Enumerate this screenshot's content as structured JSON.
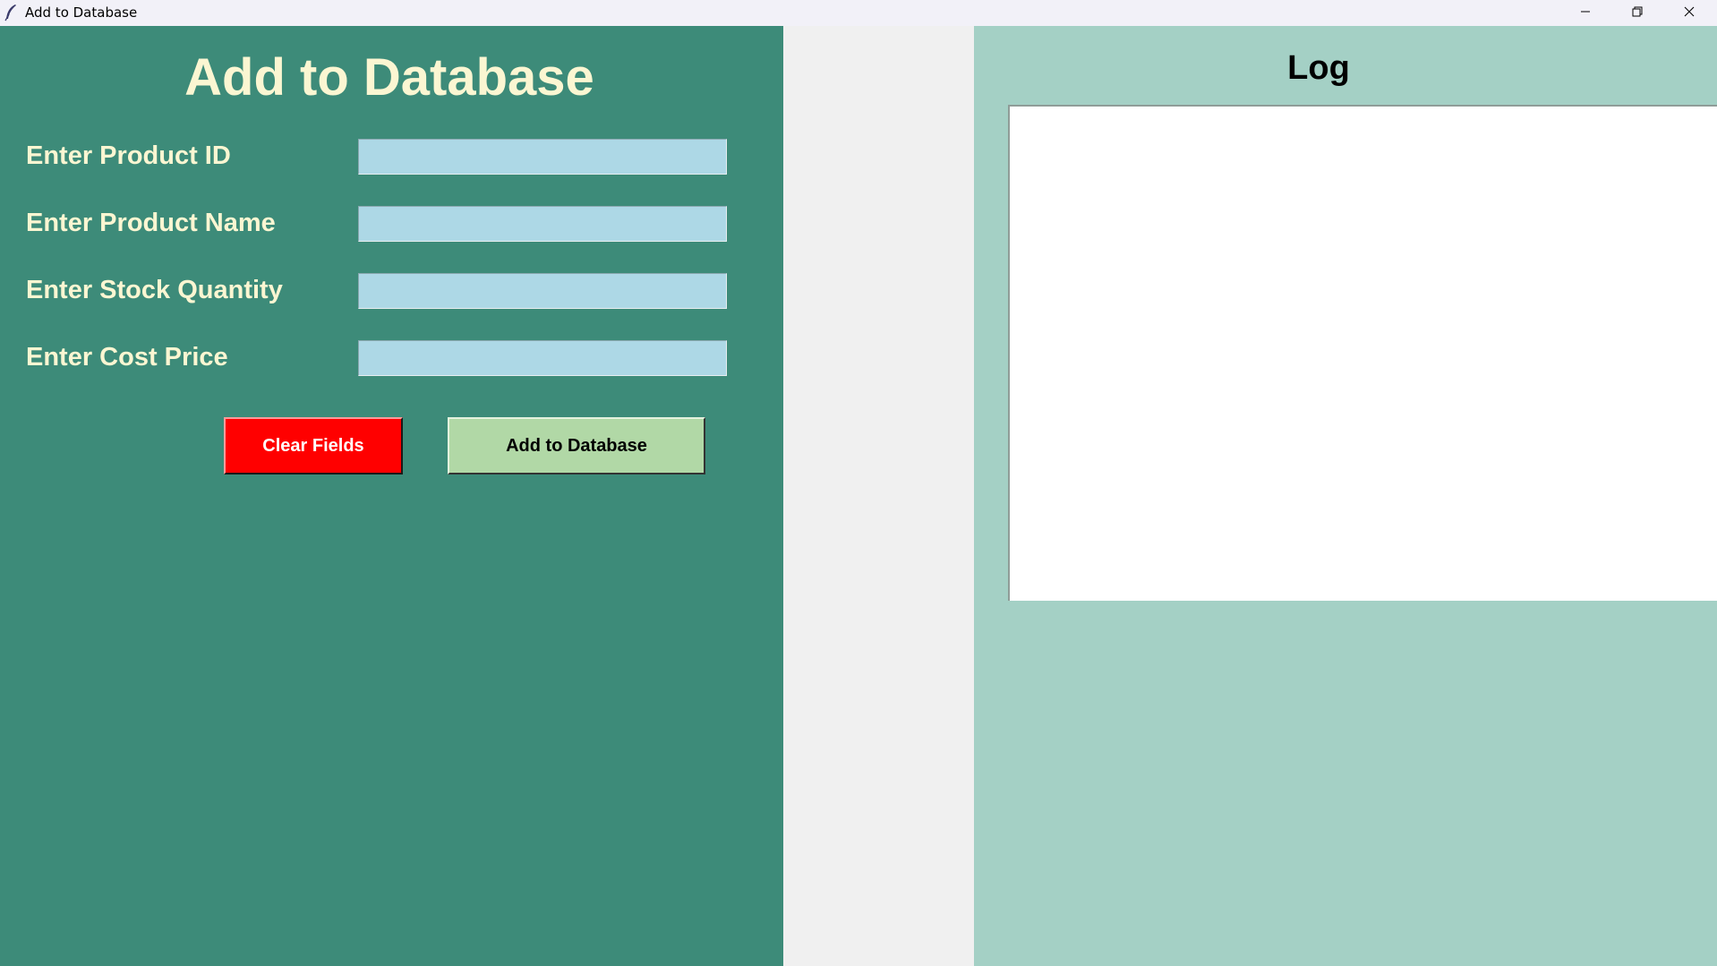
{
  "window": {
    "title": "Add to Database",
    "app_icon": "feather-icon",
    "controls": {
      "minimize_icon": "minimize-icon",
      "maximize_icon": "restore-icon",
      "close_icon": "close-icon"
    }
  },
  "form": {
    "heading": "Add to Database",
    "fields": [
      {
        "label": "Enter Product ID",
        "value": ""
      },
      {
        "label": "Enter Product Name",
        "value": ""
      },
      {
        "label": "Enter Stock Quantity",
        "value": ""
      },
      {
        "label": "Enter Cost Price",
        "value": ""
      }
    ],
    "buttons": {
      "clear_label": "Clear Fields",
      "add_label": "Add to Database"
    }
  },
  "log": {
    "heading": "Log",
    "content": ""
  },
  "colors": {
    "left_panel_bg": "#3d8b79",
    "right_panel_bg": "#a4d0c5",
    "label_text": "#fbf6d2",
    "input_bg": "#add8e6",
    "clear_button_bg": "#ff0000",
    "add_button_bg": "#b1d8a6"
  }
}
